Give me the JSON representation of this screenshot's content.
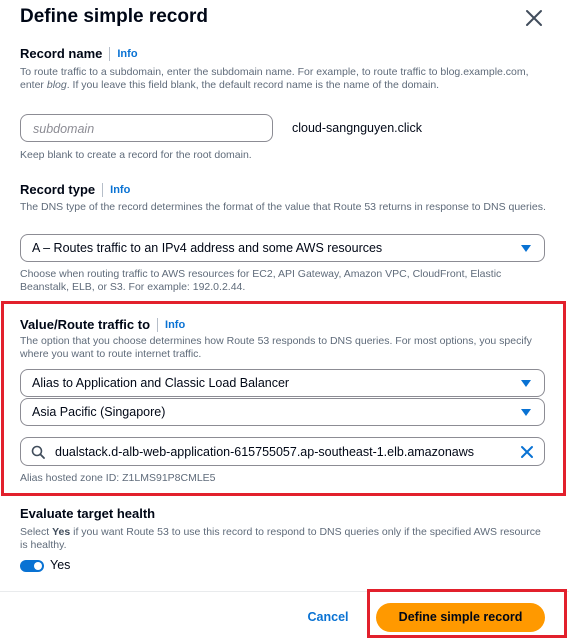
{
  "title": "Define simple record",
  "record_name": {
    "label": "Record name",
    "info": "Info",
    "description_part1": "To route traffic to a subdomain, enter the subdomain name. For example, to route traffic to blog.example.com, enter ",
    "description_em": "blog",
    "description_part2": ". If you leave this field blank, the default record name is the name of the domain.",
    "placeholder": "subdomain",
    "domain_suffix": "cloud-sangnguyen.click",
    "hint": "Keep blank to create a record for the root domain."
  },
  "record_type": {
    "label": "Record type",
    "info": "Info",
    "description": "The DNS type of the record determines the format of the value that Route 53 returns in response to DNS queries.",
    "selected": "A – Routes traffic to an IPv4 address and some AWS resources",
    "hint": "Choose when routing traffic to AWS resources for EC2, API Gateway, Amazon VPC, CloudFront, Elastic Beanstalk, ELB, or S3. For example: 192.0.2.44."
  },
  "value_route": {
    "label": "Value/Route traffic to",
    "info": "Info",
    "description": "The option that you choose determines how Route 53 responds to DNS queries. For most options, you specify where you want to route internet traffic.",
    "endpoint_selected": "Alias to Application and Classic Load Balancer",
    "region_selected": "Asia Pacific (Singapore)",
    "search_value": "dualstack.d-alb-web-application-615755057.ap-southeast-1.elb.amazonaws",
    "hosted_zone": "Alias hosted zone ID: Z1LMS91P8CMLE5"
  },
  "health": {
    "label": "Evaluate target health",
    "description_part1": "Select ",
    "description_bold": "Yes",
    "description_part2": " if you want Route 53 to use this record to respond to DNS queries only if the specified AWS resource is healthy.",
    "toggle_on": true,
    "toggle_label": "Yes"
  },
  "footer": {
    "cancel": "Cancel",
    "submit": "Define simple record"
  },
  "colors": {
    "accent": "#0972d3",
    "primary_button": "#ff9900",
    "highlight_box": "#e2202c"
  },
  "icons": [
    "close-icon",
    "caret-down-icon",
    "search-icon",
    "clear-icon"
  ]
}
